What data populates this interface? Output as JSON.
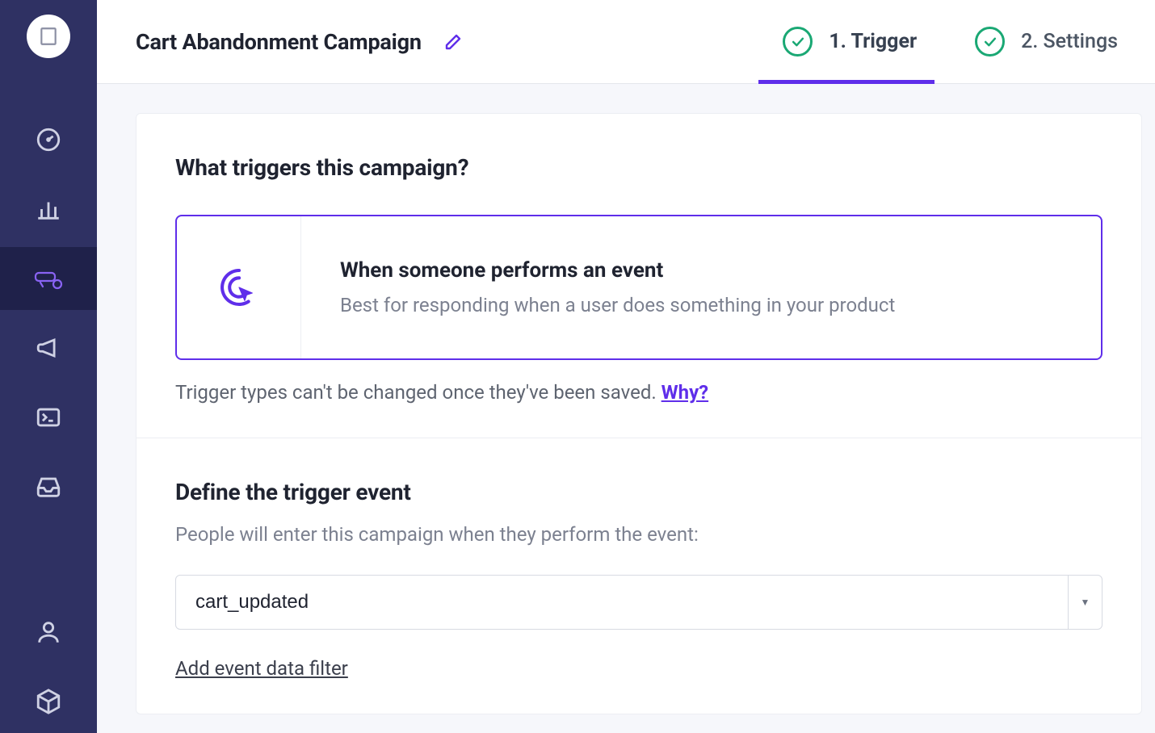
{
  "header": {
    "title": "Cart Abandonment Campaign",
    "steps": [
      {
        "label": "1. Trigger",
        "active": true,
        "complete": true
      },
      {
        "label": "2. Settings",
        "active": false,
        "complete": true
      }
    ]
  },
  "sidebar": {
    "items": [
      {
        "name": "dashboard",
        "icon": "gauge-icon"
      },
      {
        "name": "analytics",
        "icon": "bar-chart-icon"
      },
      {
        "name": "campaigns",
        "icon": "campaigns-icon",
        "active": true
      },
      {
        "name": "broadcasts",
        "icon": "megaphone-icon"
      },
      {
        "name": "terminal",
        "icon": "terminal-icon"
      },
      {
        "name": "inbox",
        "icon": "inbox-icon"
      },
      {
        "name": "people",
        "icon": "user-icon"
      },
      {
        "name": "objects",
        "icon": "cube-icon"
      }
    ]
  },
  "trigger_section": {
    "heading": "What triggers this campaign?",
    "card": {
      "title": "When someone performs an event",
      "desc": "Best for responding when a user does something in your product"
    },
    "note_text": "Trigger types can't be changed once they've been saved. ",
    "note_link": "Why?"
  },
  "define_section": {
    "heading": "Define the trigger event",
    "subhead": "People will enter this campaign when they perform the event:",
    "event_value": "cart_updated",
    "add_filter_label": "Add event data filter"
  },
  "colors": {
    "accent": "#5f2eea",
    "success": "#1aa874"
  }
}
